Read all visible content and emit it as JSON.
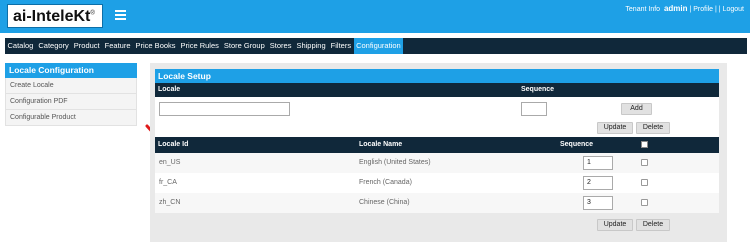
{
  "header": {
    "logo_text": "ai-InteleKt",
    "logo_mark": "®",
    "tenant_info_label": "Tenant Info",
    "user_name": "admin",
    "separator_1": "|",
    "profile_label": "Profile",
    "separator_2": "| |",
    "logout_label": "Logout",
    "menu_icon": "hamburger-menu-icon",
    "brand_color": "#1ea0e6"
  },
  "nav": {
    "items": [
      "Catalog",
      "Category",
      "Product",
      "Feature",
      "Price Books",
      "Price Rules",
      "Store Group",
      "Stores",
      "Shipping",
      "Filters",
      "Configuration"
    ],
    "active": "Configuration",
    "background": "#10283a"
  },
  "sidebar": {
    "title": "Locale Configuration",
    "items": [
      "Create Locale",
      "Configuration PDF",
      "Configurable Product"
    ]
  },
  "main": {
    "title": "Locale Setup",
    "setup_columns": {
      "locale": "Locale",
      "sequence": "Sequence"
    },
    "locale_input_value": "",
    "sequence_input_value": "",
    "add_label": "Add",
    "update_label": "Update",
    "delete_label": "Delete",
    "table": {
      "columns": {
        "id": "Locale Id",
        "name": "Locale Name",
        "sequence": "Sequence"
      },
      "rows": [
        {
          "id": "en_US",
          "name": "English (United States)",
          "sequence": "1",
          "checked": false
        },
        {
          "id": "fr_CA",
          "name": "French (Canada)",
          "sequence": "2",
          "checked": false
        },
        {
          "id": "zh_CN",
          "name": "Chinese (China)",
          "sequence": "3",
          "checked": false
        }
      ]
    },
    "annotation_arrow_color": "#e01b1b"
  }
}
